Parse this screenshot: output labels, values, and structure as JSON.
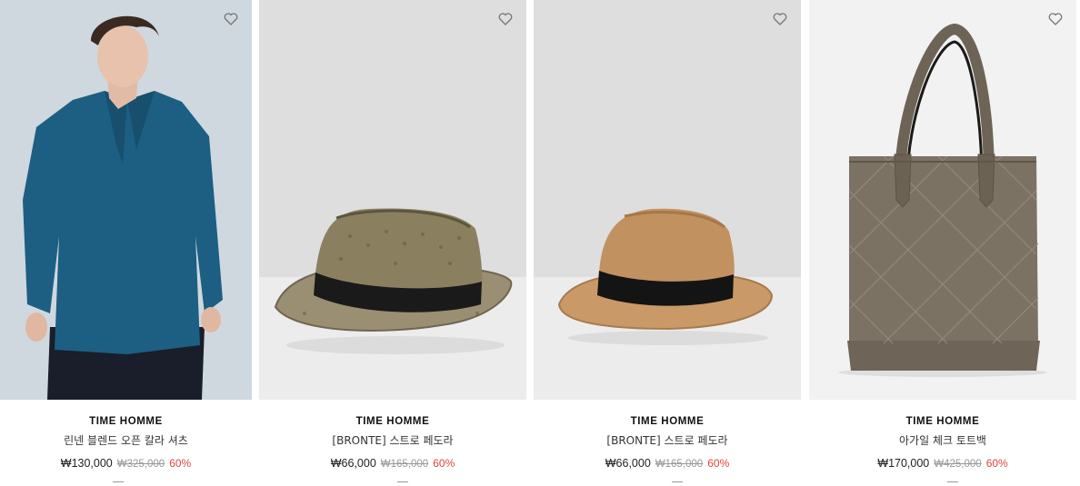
{
  "products": [
    {
      "brand": "TIME HOMME",
      "name": "린넨 블렌드 오픈 칼라 셔츠",
      "price": "₩130,000",
      "original_price": "₩325,000",
      "discount": "60%",
      "image_icon": "shirt-model-photo",
      "bg_color": "#cdd6dc"
    },
    {
      "brand": "TIME HOMME",
      "name": "[BRONTE] 스트로 페도라",
      "price": "₩66,000",
      "original_price": "₩165,000",
      "discount": "60%",
      "image_icon": "straw-fedora-photo",
      "bg_color": "#dcdcdc"
    },
    {
      "brand": "TIME HOMME",
      "name": "[BRONTE] 스트로 페도라",
      "price": "₩66,000",
      "original_price": "₩165,000",
      "discount": "60%",
      "image_icon": "tan-fedora-photo",
      "bg_color": "#dcdcdc"
    },
    {
      "brand": "TIME HOMME",
      "name": "아가일 체크 토트백",
      "price": "₩170,000",
      "original_price": "₩425,000",
      "discount": "60%",
      "image_icon": "woven-tote-bag-photo",
      "bg_color": "#f1f1f1"
    }
  ],
  "colors": {
    "discount": "#e0463e",
    "heart": "#777777"
  }
}
